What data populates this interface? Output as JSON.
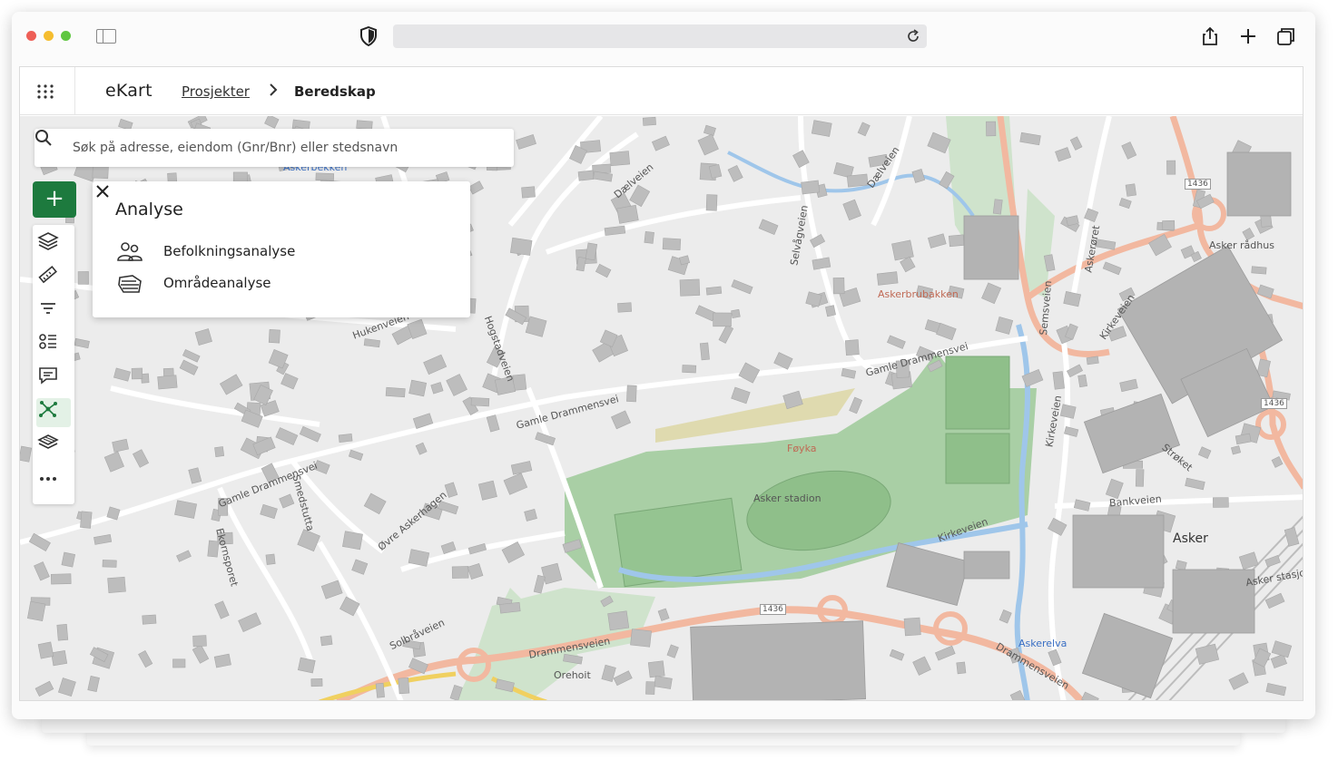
{
  "browser": {
    "url": ""
  },
  "app": {
    "brand": "eKart",
    "breadcrumb": {
      "parent": "Prosjekter",
      "current": "Beredskap"
    }
  },
  "search": {
    "placeholder": "Søk på adresse, eiendom (Gnr/Bnr) eller stedsnavn",
    "value": ""
  },
  "toolbar": {
    "add_label": "+",
    "tools": [
      "layers-icon",
      "measure-icon",
      "filter-icon",
      "legend-icon",
      "comment-icon",
      "analysis-icon",
      "basemap-icon",
      "more-icon"
    ],
    "active_tool": "analysis-icon"
  },
  "panel": {
    "title": "Analyse",
    "items": [
      {
        "label": "Befolkningsanalyse",
        "icon": "population-icon"
      },
      {
        "label": "Områdeanalyse",
        "icon": "area-icon"
      }
    ]
  },
  "map": {
    "labels": {
      "daelveien": "Dælveien",
      "daelveien2": "Dælveien",
      "selvagveien": "Selvågveien",
      "askerbrubakken": "Askerbrubakken",
      "asker_radhus": "Asker rådhus",
      "semsveien": "Semsveien",
      "kirkeveien": "Kirkeveien",
      "kirkeveien2": "Kirkeveien",
      "kirkeveien3": "Kirkeveien",
      "gamle_dr1": "Gamle Drammensvei",
      "gamle_dr2": "Gamle Drammensvei",
      "gamle_dr3": "Gamle Drammensvei",
      "hukenveien": "Hukenveien",
      "hogstadveien": "Hogstadveien",
      "foyka": "Føyka",
      "asker_stadion": "Asker stadion",
      "bankveien": "Bankveien",
      "asker": "Asker",
      "asker_stasjon": "Asker stasjon",
      "askerelva": "Askerelva",
      "drammensveien1": "Drammensveien",
      "drammensveien2": "Drammensveien",
      "orehoit": "Orehoit",
      "solbraveien": "Solbråveien",
      "ovre_askerhagen": "Øvre Askerhagen",
      "road_1436a": "1436",
      "road_1436b": "1436",
      "road_1436c": "1436",
      "smedstua": "Smedstutta",
      "ekornsporet": "Ekornsporet",
      "stroket": "Strøket",
      "askerbekken": "Askerbekken",
      "askeroret": "Askerøret"
    },
    "colors": {
      "base": "#ececec",
      "building": "#bdbdbd",
      "road": "#ffffff",
      "main_road": "#f2b8a0",
      "park": "#a9cfa5",
      "water": "#9fc6ea",
      "accent": "#1d7a3e"
    }
  }
}
